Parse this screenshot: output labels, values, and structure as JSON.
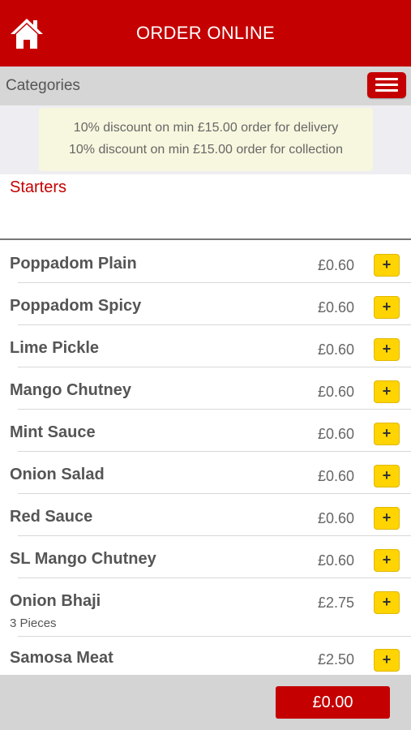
{
  "header": {
    "title": "ORDER ONLINE",
    "home_icon": "home-icon",
    "bg_color": "#c40000"
  },
  "categories": {
    "label": "Categories",
    "menu_icon": "hamburger-menu-icon"
  },
  "discounts": [
    "10% discount on min £15.00 order for delivery",
    "10% discount on min £15.00 order for collection"
  ],
  "section": {
    "title": "Starters"
  },
  "items": [
    {
      "name": "Poppadom Plain",
      "price": "£0.60",
      "add": "+"
    },
    {
      "name": "Poppadom Spicy",
      "price": "£0.60",
      "add": "+"
    },
    {
      "name": "Lime Pickle",
      "price": "£0.60",
      "add": "+"
    },
    {
      "name": "Mango Chutney",
      "price": "£0.60",
      "add": "+"
    },
    {
      "name": "Mint Sauce",
      "price": "£0.60",
      "add": "+"
    },
    {
      "name": "Onion Salad",
      "price": "£0.60",
      "add": "+"
    },
    {
      "name": "Red Sauce",
      "price": "£0.60",
      "add": "+"
    },
    {
      "name": "SL Mango Chutney",
      "price": "£0.60",
      "add": "+"
    },
    {
      "name": "Onion Bhaji",
      "sub": "3 Pieces",
      "price": "£2.75",
      "add": "+"
    },
    {
      "name": "Samosa  Meat",
      "price": "£2.50",
      "add": "+"
    }
  ],
  "cart": {
    "total": "£0.00"
  }
}
